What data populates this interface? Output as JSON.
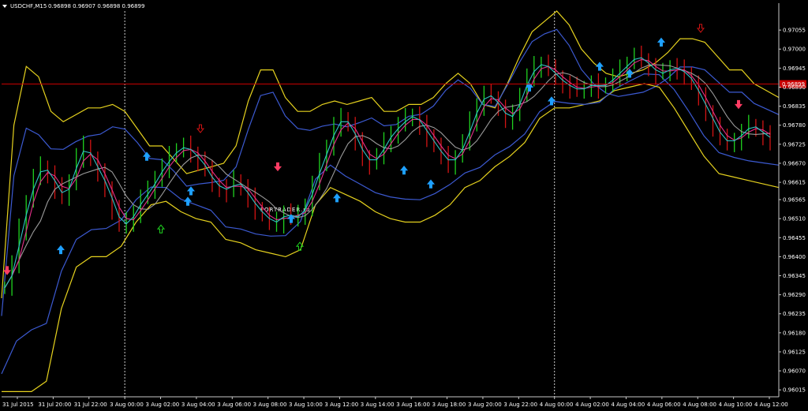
{
  "header": {
    "symbol_label": "USDCHF,M15",
    "ohlc_text": "0.96898 0.96907 0.96898 0.96899"
  },
  "watermark": "FORTRADER.ru",
  "price_marker": {
    "label": "0.96899",
    "price": 0.96899
  },
  "colors": {
    "background": "#000000",
    "axis": "#c8c8c8",
    "bull_bar": "#1fd21f",
    "bear_bar": "#d21414",
    "bollinger_outer": "#e6d21e",
    "bollinger_inner": "#3c5ad2",
    "ma_fast": "#2ec4c4",
    "ma_slow": "#e6308a",
    "ma_mid": "#9a9a9a",
    "price_line": "#c80000",
    "up_arrow": "#1ea0ff",
    "down_arrow": "#ff3c64"
  },
  "chart_data": {
    "type": "line",
    "title": "USDCHF,M15",
    "ylim": [
      0.95995,
      0.9711
    ],
    "y_ticks": [
      "0.97055",
      "0.97000",
      "0.96945",
      "0.96890",
      "0.96835",
      "0.96780",
      "0.96725",
      "0.96670",
      "0.96615",
      "0.96565",
      "0.96510",
      "0.96455",
      "0.96400",
      "0.96345",
      "0.96290",
      "0.96235",
      "0.96180",
      "0.96125",
      "0.96070",
      "0.96015"
    ],
    "x_ticks": [
      "31 Jul 2015",
      "31 Jul 20:00",
      "31 Jul 22:00",
      "3 Aug 00:00",
      "3 Aug 02:00",
      "3 Aug 04:00",
      "3 Aug 06:00",
      "3 Aug 08:00",
      "3 Aug 10:00",
      "3 Aug 12:00",
      "3 Aug 14:00",
      "3 Aug 16:00",
      "3 Aug 18:00",
      "3 Aug 20:00",
      "3 Aug 22:00",
      "4 Aug 00:00",
      "4 Aug 02:00",
      "4 Aug 04:00",
      "4 Aug 06:00",
      "4 Aug 08:00",
      "4 Aug 10:00",
      "4 Aug 12:00"
    ],
    "separators": [
      "3 Aug 00:00",
      "4 Aug 00:00"
    ],
    "close_path": [
      0.9631,
      0.9638,
      0.9648,
      0.9656,
      0.9663,
      0.9666,
      0.9664,
      0.966,
      0.9657,
      0.9662,
      0.9669,
      0.9672,
      0.9668,
      0.9664,
      0.966,
      0.9654,
      0.9649,
      0.965,
      0.9653,
      0.9657,
      0.9659,
      0.9663,
      0.9666,
      0.9669,
      0.9671,
      0.9672,
      0.967,
      0.9668,
      0.9665,
      0.9661,
      0.966,
      0.9659,
      0.9662,
      0.966,
      0.9657,
      0.9654,
      0.9652,
      0.965,
      0.965,
      0.9653,
      0.9651,
      0.9652,
      0.9655,
      0.9661,
      0.9667,
      0.9672,
      0.9678,
      0.968,
      0.9678,
      0.9673,
      0.9669,
      0.9667,
      0.9669,
      0.9673,
      0.9676,
      0.9678,
      0.968,
      0.9681,
      0.9678,
      0.9675,
      0.9672,
      0.9669,
      0.9667,
      0.9669,
      0.9673,
      0.9679,
      0.9684,
      0.9687,
      0.9686,
      0.9683,
      0.968,
      0.9681,
      0.9687,
      0.9692,
      0.9695,
      0.9696,
      0.9694,
      0.9692,
      0.969,
      0.9689,
      0.9688,
      0.9689,
      0.969,
      0.9689,
      0.969,
      0.9692,
      0.9694,
      0.9696,
      0.9698,
      0.9697,
      0.9695,
      0.9693,
      0.9693,
      0.9695,
      0.9694,
      0.9693,
      0.969,
      0.9686,
      0.9682,
      0.9678,
      0.9674,
      0.9673,
      0.9674,
      0.9676,
      0.9678,
      0.9677,
      0.9675,
      0.9674
    ],
    "series": [
      {
        "name": "",
        "role": "upper",
        "values": [
          0.9628,
          0.9678,
          0.9695,
          0.9692,
          0.9682,
          0.9679,
          0.9681,
          0.9683,
          0.9683,
          0.9684,
          0.9682,
          0.9677,
          0.9672,
          0.9672,
          0.9668,
          0.9664,
          0.9665,
          0.9666,
          0.9667,
          0.9672,
          0.9685,
          0.9694,
          0.9694,
          0.9686,
          0.9682,
          0.9682,
          0.9684,
          0.9685,
          0.9684,
          0.9685,
          0.9686,
          0.9682,
          0.9682,
          0.9684,
          0.9684,
          0.9686,
          0.969,
          0.9693,
          0.969,
          0.9684,
          0.9683,
          0.969,
          0.9698,
          0.9705,
          0.9708,
          0.9711,
          0.9707,
          0.97,
          0.9696,
          0.9693,
          0.9692,
          0.9693,
          0.9694,
          0.9696,
          0.9699,
          0.9703,
          0.9703,
          0.9702,
          0.9698,
          0.9694,
          0.9694,
          0.969,
          0.9688,
          0.9686
        ]
      },
      {
        "name": "",
        "role": "lower",
        "values": [
          0.9601,
          0.9601,
          0.9601,
          0.9604,
          0.9625,
          0.9637,
          0.964,
          0.964,
          0.9643,
          0.965,
          0.9655,
          0.9656,
          0.9653,
          0.9651,
          0.965,
          0.9645,
          0.9644,
          0.9642,
          0.9641,
          0.964,
          0.9642,
          0.9655,
          0.966,
          0.9658,
          0.9656,
          0.9653,
          0.9651,
          0.965,
          0.965,
          0.9652,
          0.9655,
          0.966,
          0.9662,
          0.9666,
          0.9669,
          0.9673,
          0.968,
          0.9683,
          0.9683,
          0.9684,
          0.9685,
          0.9688,
          0.9689,
          0.969,
          0.9689,
          0.9683,
          0.9676,
          0.9669,
          0.9664,
          0.9663,
          0.9662,
          0.9661,
          0.966
        ]
      }
    ],
    "up_arrows": [
      [
        77,
        0.9642
      ],
      [
        186,
        0.9669
      ],
      [
        242,
        0.9659
      ],
      [
        238,
        0.9656
      ],
      [
        369,
        0.9651
      ],
      [
        427,
        0.9657
      ],
      [
        512,
        0.9665
      ],
      [
        546,
        0.9661
      ],
      [
        671,
        0.9689
      ],
      [
        699,
        0.9685
      ],
      [
        760,
        0.9695
      ],
      [
        798,
        0.9693
      ],
      [
        838,
        0.9702
      ]
    ],
    "down_arrows": [
      [
        9,
        0.9636
      ],
      [
        352,
        0.9666
      ],
      [
        936,
        0.9684
      ]
    ],
    "hollow_up_arrows": [
      [
        204,
        0.9648
      ],
      [
        380,
        0.9643
      ]
    ],
    "hollow_down_arrows": [
      [
        254,
        0.9677
      ],
      [
        888,
        0.9706
      ]
    ]
  }
}
